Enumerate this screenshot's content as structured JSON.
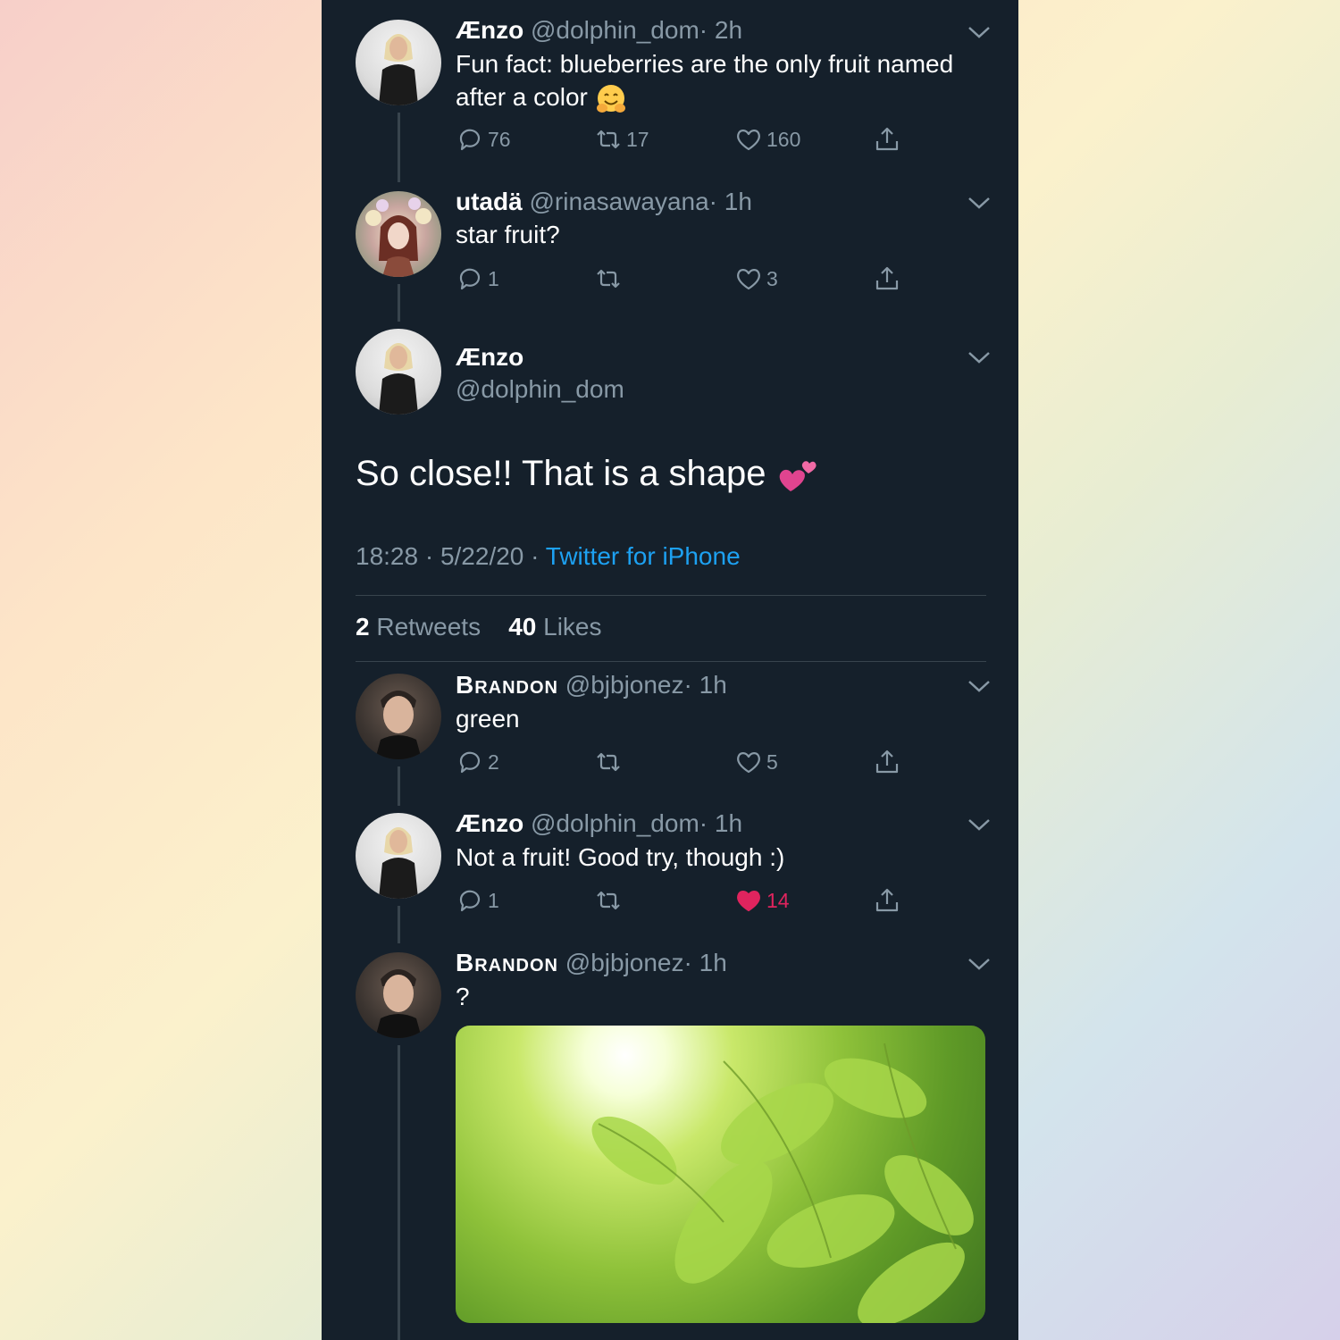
{
  "colors": {
    "background": "#15202b",
    "text": "#ffffff",
    "muted": "#8899a6",
    "link": "#1da1f2",
    "liked": "#e0245e",
    "divider": "#38444d"
  },
  "tweets": [
    {
      "name": "Ænzo",
      "handle": "@dolphin_dom",
      "time": "· 2h",
      "text": "Fun fact: blueberries are the only fruit named after a color",
      "emoji": "hugging-face-icon",
      "replies": "76",
      "retweets": "17",
      "likes": "160"
    },
    {
      "name": "utadä",
      "handle": "@rinasawayana",
      "time": "· 1h",
      "text": "star fruit?",
      "replies": "1",
      "retweets": "",
      "likes": "3"
    }
  ],
  "main_tweet": {
    "name": "Ænzo",
    "handle": "@dolphin_dom",
    "text": "So close!! That is a shape",
    "emoji": "two-hearts-icon",
    "time": "18:28 · 5/22/20 ·",
    "source": "Twitter for iPhone",
    "retweet_count": "2",
    "retweet_label": "Retweets",
    "like_count": "40",
    "like_label": "Likes"
  },
  "replies": [
    {
      "name": "Brandon",
      "handle": "@bjbjonez",
      "time": "· 1h",
      "text": "green",
      "replies": "2",
      "retweets": "",
      "likes": "5"
    },
    {
      "name": "Ænzo",
      "handle": "@dolphin_dom",
      "time": "· 1h",
      "text": "Not a fruit! Good try, though :)",
      "replies": "1",
      "retweets": "",
      "likes": "14",
      "liked": true
    },
    {
      "name": "Brandon",
      "handle": "@bjbjonez",
      "time": "· 1h",
      "text": "?",
      "media": "green-leaves-photo"
    }
  ]
}
